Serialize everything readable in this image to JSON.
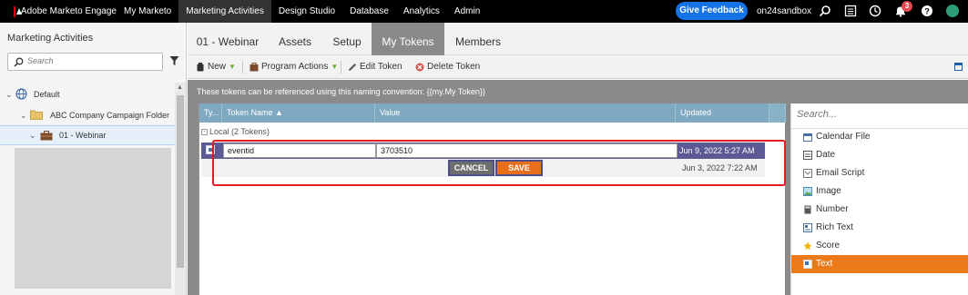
{
  "topbar": {
    "brand": "Adobe Marketo Engage",
    "nav": [
      "My Marketo",
      "Marketing Activities",
      "Design Studio",
      "Database",
      "Analytics",
      "Admin"
    ],
    "active_nav": "Marketing Activities",
    "feedback_label": "Give Feedback",
    "account": "on24sandbox",
    "notification_count": "3"
  },
  "left_panel": {
    "title": "Marketing Activities",
    "search_placeholder": "Search",
    "tree": [
      {
        "label": "Default",
        "icon": "globe-icon"
      },
      {
        "label": "ABC Company Campaign Folder",
        "icon": "folder-icon"
      },
      {
        "label": "01 - Webinar",
        "icon": "briefcase-icon",
        "selected": true
      }
    ]
  },
  "tabs": [
    "01 - Webinar",
    "Assets",
    "Setup",
    "My Tokens",
    "Members"
  ],
  "active_tab": "My Tokens",
  "toolbar": {
    "new_label": "New",
    "program_actions_label": "Program Actions",
    "edit_token_label": "Edit Token",
    "delete_token_label": "Delete Token"
  },
  "info_text": "These tokens can be referenced using this naming convention: {{my.My Token}}",
  "grid": {
    "columns": [
      "Ty...",
      "Token Name ▲",
      "Value",
      "Updated"
    ],
    "group_label": "Local (2 Tokens)",
    "rows": [
      {
        "name": "eventid",
        "value": "3703510",
        "updated": "Jun 9, 2022 5:27 AM",
        "editing": true
      },
      {
        "name": "",
        "value": "",
        "updated": "Jun 3, 2022 7:22 AM",
        "editing": false
      }
    ],
    "cancel_label": "CANCEL",
    "save_label": "SAVE"
  },
  "palette": {
    "search_placeholder": "Search...",
    "items": [
      {
        "label": "Calendar File",
        "icon": "calendar-icon"
      },
      {
        "label": "Date",
        "icon": "date-icon"
      },
      {
        "label": "Email Script",
        "icon": "email-script-icon"
      },
      {
        "label": "Image",
        "icon": "image-icon"
      },
      {
        "label": "Number",
        "icon": "number-icon"
      },
      {
        "label": "Rich Text",
        "icon": "rich-text-icon"
      },
      {
        "label": "Score",
        "icon": "star-icon"
      },
      {
        "label": "Text",
        "icon": "text-icon",
        "active": true
      }
    ]
  },
  "colors": {
    "accent_orange": "#e86f1c",
    "selected_row": "#5b5a95",
    "grid_header": "#7fa9c0",
    "feedback_blue": "#1473e6",
    "highlight_red": "#e31b23"
  }
}
